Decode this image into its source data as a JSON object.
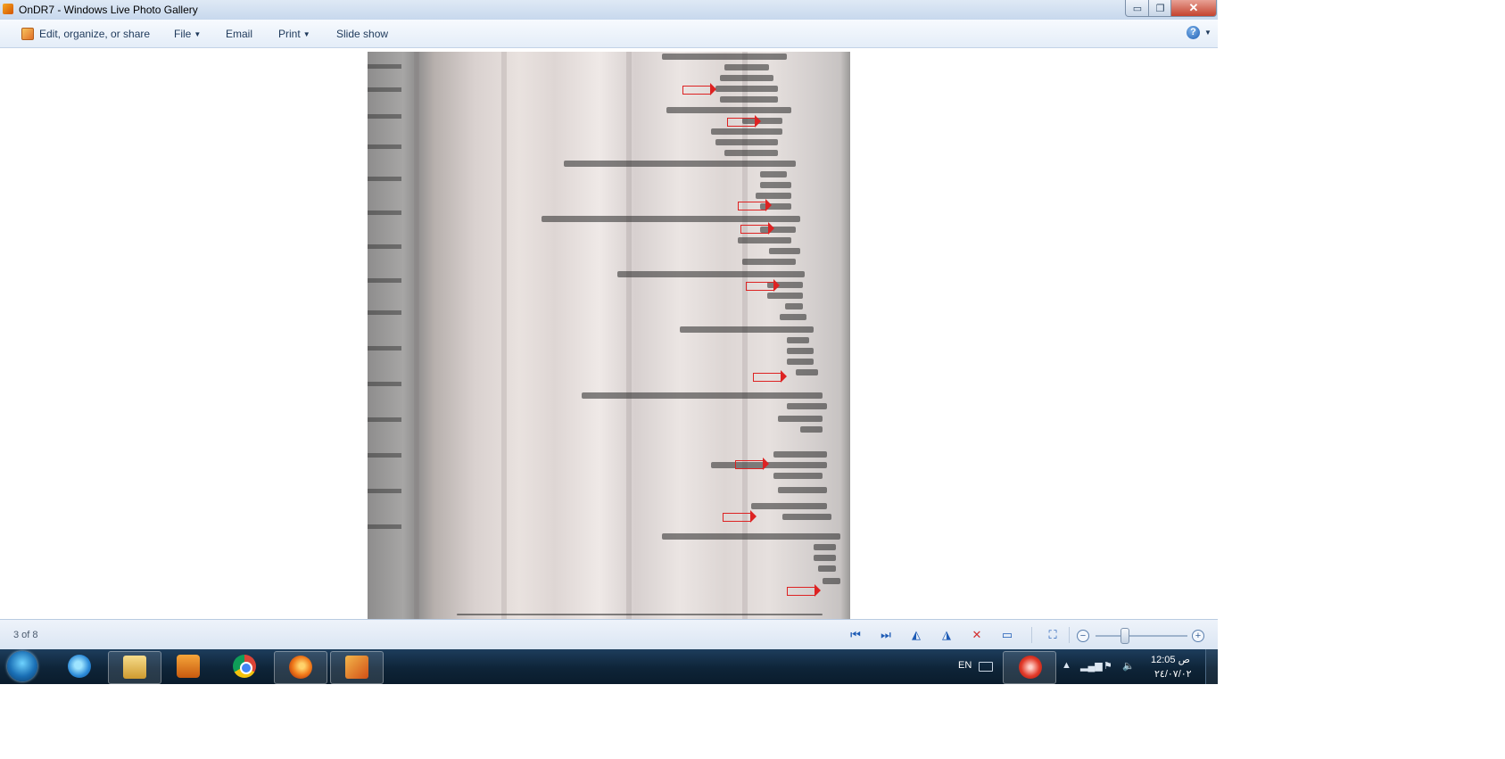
{
  "window": {
    "title": "OnDR7 - Windows Live Photo Gallery",
    "min_label": "▭",
    "max_label": "❐",
    "close_label": "✕"
  },
  "toolbar": {
    "edit_label": "Edit, organize, or share",
    "file_label": "File",
    "email_label": "Email",
    "print_label": "Print",
    "slideshow_label": "Slide show",
    "help_label": "?"
  },
  "statusbar": {
    "page_count": "3 of 8",
    "icons": [
      "previous-icon",
      "next-icon",
      "rotate-left-icon",
      "rotate-right-icon",
      "delete-icon",
      "slideshow-icon",
      "actual-size-icon"
    ],
    "zoom_out_label": "−",
    "zoom_in_label": "+",
    "zoom_level": 0.3
  },
  "taskbar": {
    "apps": [
      "internet-explorer",
      "windows-explorer",
      "media-player",
      "chrome",
      "firefox",
      "photo-gallery"
    ],
    "active_apps": [
      "windows-explorer",
      "firefox",
      "photo-gallery"
    ],
    "language": "EN",
    "clock_time": "12:05 ص",
    "clock_date": "٢٤/٠٧/٠٢"
  },
  "colors": {
    "accent": "#1d5bb5",
    "close_button": "#c4432f",
    "taskbar": "#0e2438",
    "annotation_arrow": "#dd2222"
  }
}
